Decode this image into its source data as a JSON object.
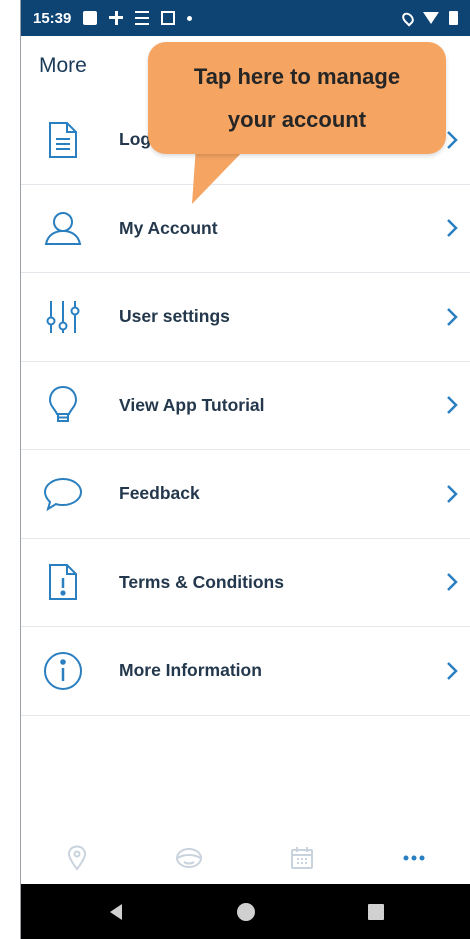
{
  "status_bar": {
    "time": "15:39",
    "left_icons": [
      "image-icon",
      "slack-icon",
      "sim-icon",
      "calendar-icon",
      "dot-icon"
    ],
    "right_icons": [
      "location-icon",
      "wifi-icon",
      "battery-icon"
    ]
  },
  "header": {
    "title": "More"
  },
  "menu": {
    "items": [
      {
        "label": "Logbook",
        "icon": "document-icon"
      },
      {
        "label": "My Account",
        "icon": "user-icon"
      },
      {
        "label": "User settings",
        "icon": "sliders-icon"
      },
      {
        "label": "View App Tutorial",
        "icon": "lightbulb-icon"
      },
      {
        "label": "Feedback",
        "icon": "chat-bubble-icon"
      },
      {
        "label": "Terms & Conditions",
        "icon": "alert-document-icon"
      },
      {
        "label": "More Information",
        "icon": "info-icon"
      }
    ]
  },
  "callout": {
    "line1": "Tap here to manage",
    "line2": "your account"
  },
  "bottom_nav": {
    "items": [
      "map-pin-icon",
      "steering-wheel-icon",
      "calendar-icon",
      "more-dots-icon"
    ],
    "active": "more-dots-icon"
  },
  "colors": {
    "accent": "#2a7fc0",
    "status_bar": "#0d4473",
    "callout": "#f5a462",
    "label": "#24384d",
    "inactive_nav": "#c9d3de"
  }
}
